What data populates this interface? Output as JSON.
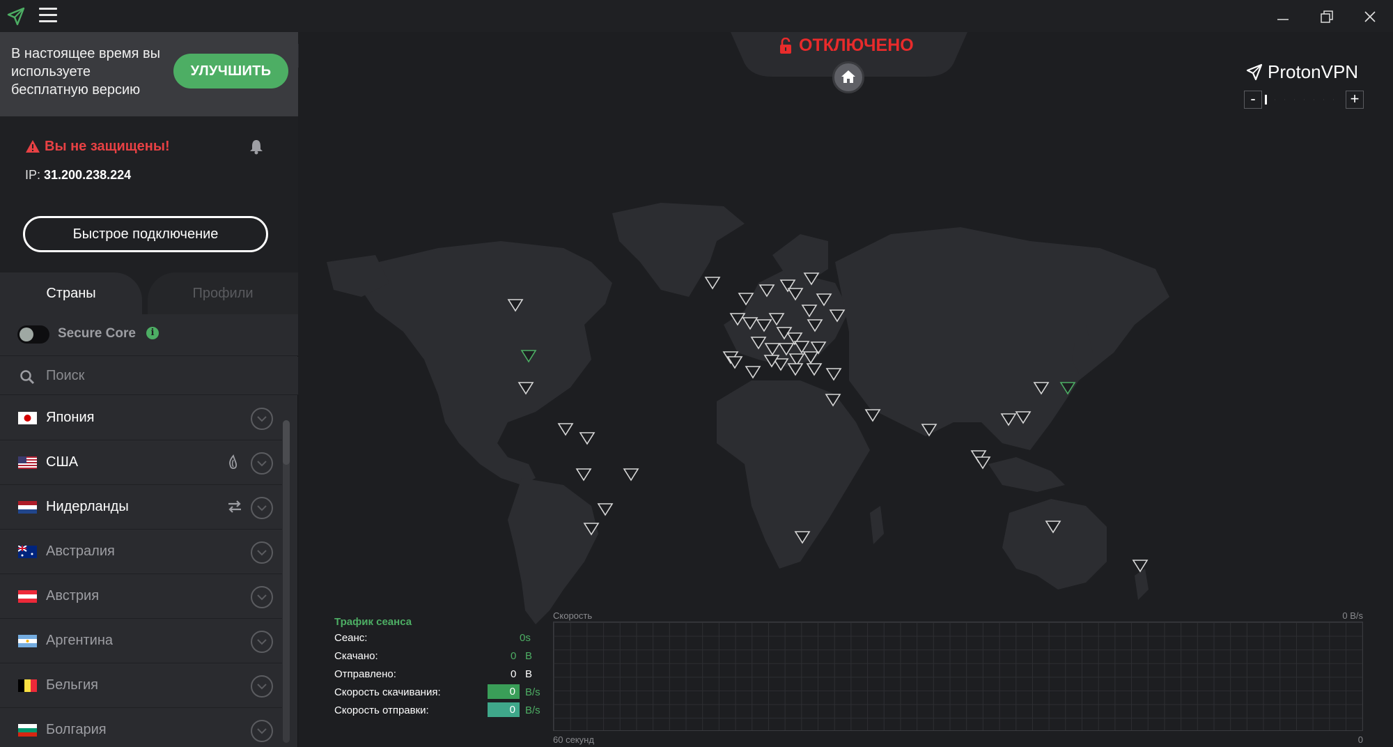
{
  "app": {
    "name": "ProtonVPN"
  },
  "upgrade": {
    "text": "В настоящее время вы используете бесплатную версию",
    "button": "УЛУЧШИТЬ"
  },
  "status": {
    "warning": "Вы не защищены!",
    "ip_label": "IP: ",
    "ip": "31.200.238.224",
    "quick_connect": "Быстрое подключение",
    "connection": "ОТКЛЮЧЕНО"
  },
  "tabs": {
    "countries": "Страны",
    "profiles": "Профили"
  },
  "secure_core": {
    "label": "Secure Core",
    "enabled": false
  },
  "search": {
    "placeholder": "Поиск",
    "value": ""
  },
  "countries": [
    {
      "name": "Япония",
      "flag": "jp",
      "dim": false,
      "feature": ""
    },
    {
      "name": "США",
      "flag": "us",
      "dim": false,
      "feature": "tor-icon"
    },
    {
      "name": "Нидерланды",
      "flag": "nl",
      "dim": false,
      "feature": "p2p-icon"
    },
    {
      "name": "Австралия",
      "flag": "au",
      "dim": true,
      "feature": ""
    },
    {
      "name": "Австрия",
      "flag": "at",
      "dim": true,
      "feature": ""
    },
    {
      "name": "Аргентина",
      "flag": "ar",
      "dim": true,
      "feature": ""
    },
    {
      "name": "Бельгия",
      "flag": "be",
      "dim": true,
      "feature": ""
    },
    {
      "name": "Болгария",
      "flag": "bg",
      "dim": true,
      "feature": ""
    }
  ],
  "traffic": {
    "title": "Трафик сеанса",
    "session_label": "Сеанс:",
    "session_value": "0s",
    "downloaded_label": "Скачано:",
    "downloaded_value": "0",
    "downloaded_unit": "B",
    "uploaded_label": "Отправлено:",
    "uploaded_value": "0",
    "uploaded_unit": "B",
    "down_speed_label": "Скорость скачивания:",
    "down_speed_value": "0",
    "down_speed_unit": "B/s",
    "up_speed_label": "Скорость отправки:",
    "up_speed_value": "0",
    "up_speed_unit": "B/s"
  },
  "graph": {
    "title": "Скорость",
    "max_label": "0  B/s",
    "time_label": "60 секунд",
    "min_label": "0"
  },
  "zoom": {
    "minus": "-",
    "plus": "+",
    "level": 0
  },
  "colors": {
    "accent": "#4dae64",
    "danger": "#e82b2b",
    "bg": "#1d1e21",
    "sidebar": "#2a2b2f"
  }
}
